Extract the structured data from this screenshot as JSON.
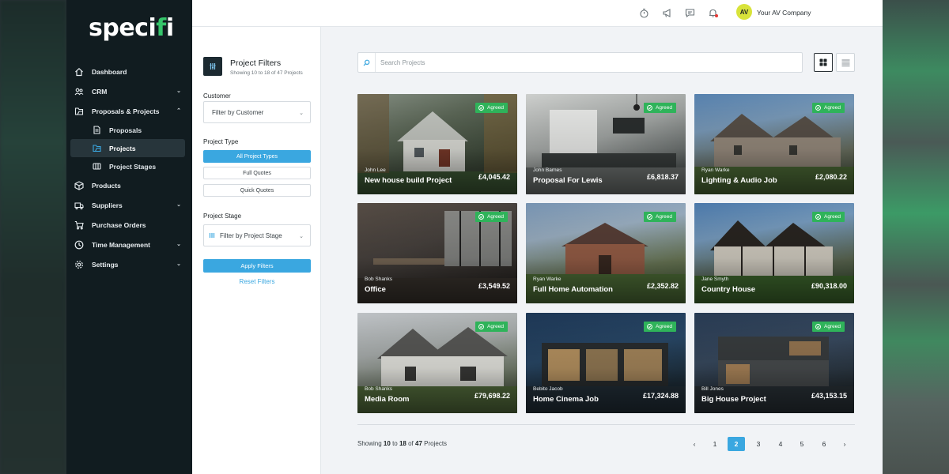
{
  "brand": {
    "name_start": "speci",
    "name_dot": "f",
    "name_end": "i"
  },
  "nav": {
    "items": [
      {
        "label": "Dashboard",
        "icon": "home-icon"
      },
      {
        "label": "CRM",
        "icon": "people-icon",
        "chevron": "down"
      },
      {
        "label": "Proposals & Projects",
        "icon": "folder-icon",
        "chevron": "up"
      },
      {
        "label": "Products",
        "icon": "box-icon"
      },
      {
        "label": "Suppliers",
        "icon": "truck-icon",
        "chevron": "down"
      },
      {
        "label": "Purchase Orders",
        "icon": "cart-icon"
      },
      {
        "label": "Time Management",
        "icon": "clock-icon",
        "chevron": "down"
      },
      {
        "label": "Settings",
        "icon": "gear-icon",
        "chevron": "down"
      }
    ],
    "sub_items": [
      {
        "label": "Proposals",
        "icon": "document-icon"
      },
      {
        "label": "Projects",
        "icon": "folder-icon",
        "active": true
      },
      {
        "label": "Project Stages",
        "icon": "columns-icon"
      }
    ]
  },
  "topbar": {
    "avatar_initials": "AV",
    "company": "Your AV Company"
  },
  "filters": {
    "title": "Project Filters",
    "subtitle": "Showing 10 to 18 of 47 Projects",
    "customer_label": "Customer",
    "customer_placeholder": "Filter by Customer",
    "type_label": "Project Type",
    "types": [
      "All Project Types",
      "Full Quotes",
      "Quick Quotes"
    ],
    "stage_label": "Project Stage",
    "stage_placeholder": "Filter by Project Stage",
    "apply": "Apply Filters",
    "reset": "Reset Filters"
  },
  "search": {
    "placeholder": "Search Projects"
  },
  "projects": [
    {
      "client": "John Lee",
      "title": "New house build Project",
      "price": "£4,045.42",
      "status": "Agreed"
    },
    {
      "client": "John Barnes",
      "title": "Proposal For Lewis",
      "price": "£6,818.37",
      "status": "Agreed"
    },
    {
      "client": "Ryan Warke",
      "title": "Lighting & Audio Job",
      "price": "£2,080.22",
      "status": "Agreed"
    },
    {
      "client": "Bob Shanks",
      "title": "Office",
      "price": "£3,549.52",
      "status": "Agreed"
    },
    {
      "client": "Ryan Warke",
      "title": "Full Home Automation",
      "price": "£2,352.82",
      "status": "Agreed"
    },
    {
      "client": "Jane Smyth",
      "title": "Country House",
      "price": "£90,318.00",
      "status": "Agreed"
    },
    {
      "client": "Bob Shanks",
      "title": "Media Room",
      "price": "£79,698.22",
      "status": "Agreed"
    },
    {
      "client": "Bebito Jacob",
      "title": "Home Cinema Job",
      "price": "£17,324.88",
      "status": "Agreed"
    },
    {
      "client": "Bill Jones",
      "title": "Big House Project",
      "price": "£43,153.15",
      "status": "Agreed"
    }
  ],
  "footer": {
    "showing_prefix": "Showing",
    "from": "10",
    "to_word": "to",
    "to": "18",
    "of_word": "of",
    "total": "47",
    "suffix": "Projects"
  },
  "pagination": {
    "prev": "‹",
    "pages": [
      "1",
      "2",
      "3",
      "4",
      "5",
      "6"
    ],
    "current": "2",
    "next": "›"
  },
  "colors": {
    "accent": "#3aa7e0",
    "agreed": "#2fb35a",
    "sidebar": "#111c20",
    "logo_dot": "#35c46a"
  }
}
